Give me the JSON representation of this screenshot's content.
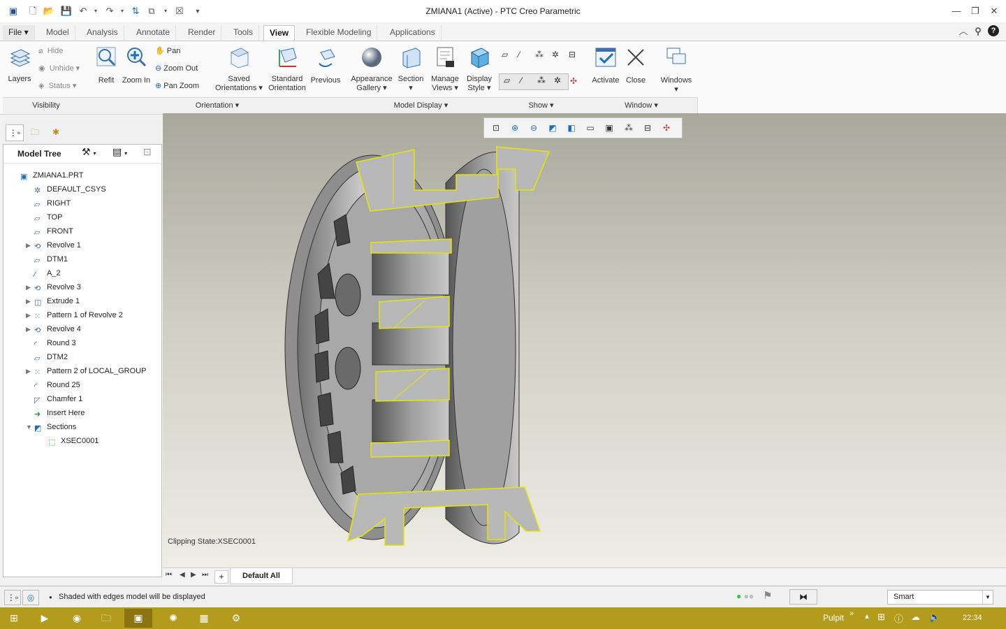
{
  "window": {
    "title": "ZMIANA1 (Active) - PTC Creo Parametric"
  },
  "tabs": [
    "File",
    "Model",
    "Analysis",
    "Annotate",
    "Render",
    "Tools",
    "View",
    "Flexible Modeling",
    "Applications"
  ],
  "active_tab": "View",
  "ribbon": {
    "visibility": {
      "layers": "Layers",
      "hide": "Hide",
      "unhide": "Unhide",
      "status": "Status",
      "group": "Visibility"
    },
    "orientation": {
      "refit": "Refit",
      "zoom_in": "Zoom In",
      "pan": "Pan",
      "zoom_out": "Zoom Out",
      "pan_zoom": "Pan Zoom",
      "saved_line1": "Saved",
      "saved_line2": "Orientations",
      "standard_line1": "Standard",
      "standard_line2": "Orientation",
      "previous": "Previous",
      "group": "Orientation"
    },
    "model_display": {
      "appearance_line1": "Appearance",
      "appearance_line2": "Gallery",
      "section": "Section",
      "manage_line1": "Manage",
      "manage_line2": "Views",
      "display_line1": "Display",
      "display_line2": "Style",
      "group": "Model Display"
    },
    "show": {
      "group": "Show"
    },
    "window": {
      "activate": "Activate",
      "close": "Close",
      "windows": "Windows",
      "group": "Window"
    }
  },
  "model_tree": {
    "title": "Model Tree",
    "items": [
      {
        "label": "ZMIANA1.PRT",
        "icon": "part-icon",
        "indent": 0,
        "expander": ""
      },
      {
        "label": "DEFAULT_CSYS",
        "icon": "csys-icon",
        "indent": 1,
        "expander": ""
      },
      {
        "label": "RIGHT",
        "icon": "datum-plane-icon",
        "indent": 1,
        "expander": ""
      },
      {
        "label": "TOP",
        "icon": "datum-plane-icon",
        "indent": 1,
        "expander": ""
      },
      {
        "label": "FRONT",
        "icon": "datum-plane-icon",
        "indent": 1,
        "expander": ""
      },
      {
        "label": "Revolve 1",
        "icon": "revolve-icon",
        "indent": 1,
        "expander": "▶"
      },
      {
        "label": "DTM1",
        "icon": "datum-plane-icon",
        "indent": 1,
        "expander": ""
      },
      {
        "label": "A_2",
        "icon": "axis-icon",
        "indent": 1,
        "expander": ""
      },
      {
        "label": "Revolve 3",
        "icon": "revolve-icon",
        "indent": 1,
        "expander": "▶"
      },
      {
        "label": "Extrude 1",
        "icon": "extrude-icon",
        "indent": 1,
        "expander": "▶"
      },
      {
        "label": "Pattern 1 of Revolve 2",
        "icon": "pattern-icon",
        "indent": 1,
        "expander": "▶"
      },
      {
        "label": "Revolve 4",
        "icon": "revolve-icon",
        "indent": 1,
        "expander": "▶"
      },
      {
        "label": "Round 3",
        "icon": "round-icon",
        "indent": 1,
        "expander": ""
      },
      {
        "label": "DTM2",
        "icon": "datum-plane-icon",
        "indent": 1,
        "expander": ""
      },
      {
        "label": "Pattern 2 of LOCAL_GROUP",
        "icon": "pattern-icon",
        "indent": 1,
        "expander": "▶"
      },
      {
        "label": "Round 25",
        "icon": "round-icon",
        "indent": 1,
        "expander": ""
      },
      {
        "label": "Chamfer 1",
        "icon": "chamfer-icon",
        "indent": 1,
        "expander": ""
      },
      {
        "label": "Insert Here",
        "icon": "insert-arrow-icon",
        "indent": 1,
        "expander": ""
      },
      {
        "label": "Sections",
        "icon": "sections-icon",
        "indent": 1,
        "expander": "▼"
      },
      {
        "label": "XSEC0001",
        "icon": "xsec-icon",
        "indent": 2,
        "expander": ""
      }
    ]
  },
  "viewport": {
    "clipping_state": "Clipping State:XSEC0001"
  },
  "bottom_tabs": {
    "default": "Default All",
    "add": "+"
  },
  "status": {
    "message": "Shaded with edges model will be displayed",
    "filter": "Smart"
  },
  "taskbar": {
    "desktop_label": "Pulpit",
    "chevron": "»",
    "clock": "22:34"
  },
  "colors": {
    "accent": "#1e6fb5",
    "taskbar": "#b39b1b",
    "section_edge": "#e6e600",
    "part_gray": "#b8b8b8"
  }
}
